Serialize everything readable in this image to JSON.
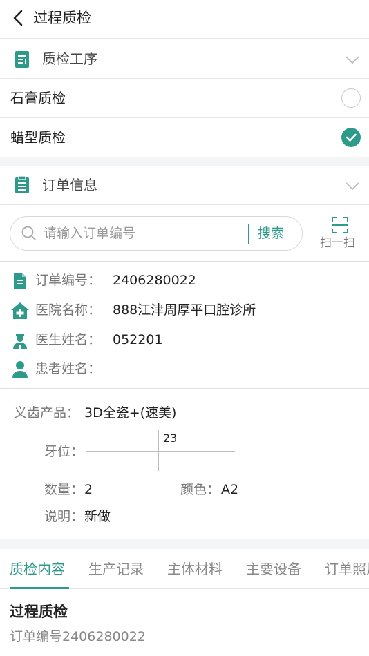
{
  "header": {
    "title": "过程质检",
    "back_icon": "chevron-left-icon"
  },
  "process_section": {
    "title": "质检工序",
    "icon": "document-list-icon",
    "items": [
      {
        "label": "石膏质检",
        "checked": false
      },
      {
        "label": "蜡型质检",
        "checked": true
      }
    ]
  },
  "order_section": {
    "title": "订单信息",
    "icon": "clipboard-icon"
  },
  "search": {
    "placeholder": "请输入订单编号",
    "button_label": "搜索",
    "scan_label": "扫一扫"
  },
  "order_info": {
    "order_no_label": "订单编号：",
    "order_no": "2406280022",
    "hospital_label": "医院名称：",
    "hospital": "888江津周厚平口腔诊所",
    "doctor_label": "医生姓名：",
    "doctor": "052201",
    "patient_label": "患者姓名：",
    "patient": ""
  },
  "product": {
    "product_label": "义齿产品：",
    "product": "3D全瓷+(速美)",
    "tooth_label": "牙位：",
    "tooth_upper_right": "23",
    "qty_label": "数量：",
    "qty": "2",
    "color_label": "颜色：",
    "color": "A2",
    "note_label": "说明：",
    "note": "新做"
  },
  "tabs": [
    "质检内容",
    "生产记录",
    "主体材料",
    "主要设备",
    "订单照片"
  ],
  "content": {
    "title": "过程质检",
    "order_line": "订单编号2406280022"
  },
  "colors": {
    "accent": "#2e9a8a",
    "background_gap": "#f4f5f7"
  }
}
